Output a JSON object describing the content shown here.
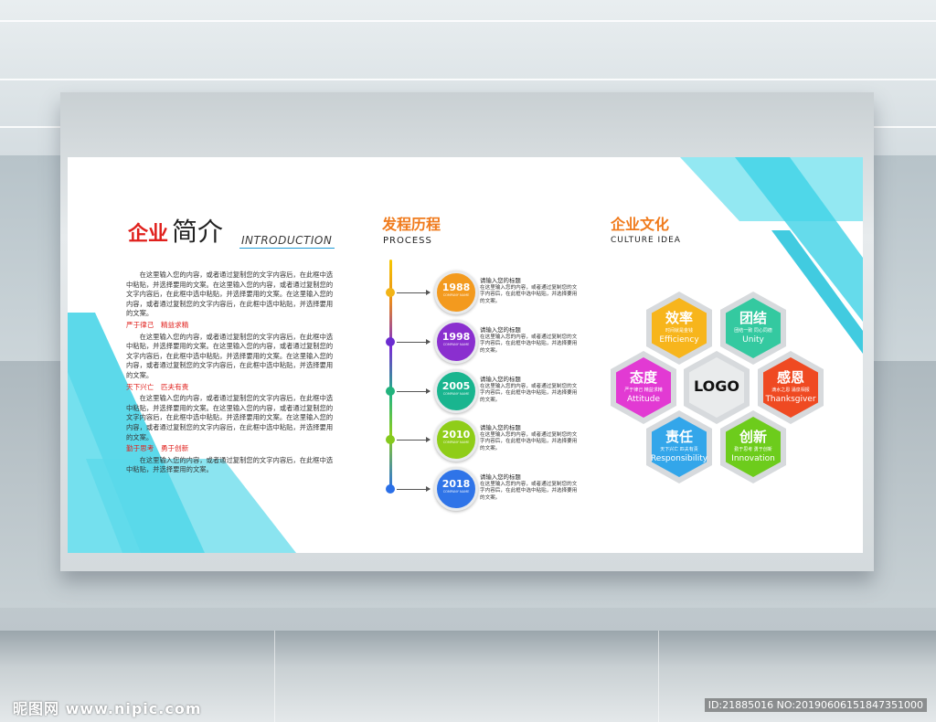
{
  "intro": {
    "title_red": "企业",
    "title_big": "简介",
    "title_en": "INTRODUCTION",
    "paragraphs": [
      "在这里输入您的内容，或者通过复制您的文字内容后，在此框中选中粘贴，并选择要用的文案。在这里输入您的内容，或者通过复制您的文字内容后，在此框中选中粘贴，并选择要用的文案。在这里输入您的内容，或者通过复制您的文字内容后，在此框中选中粘贴，并选择要用的文案。",
      "在这里输入您的内容，或者通过复制您的文字内容后，在此框中选中粘贴，并选择要用的文案。在这里输入您的内容，或者通过复制您的文字内容后，在此框中选中粘贴，并选择要用的文案。在这里输入您的内容，或者通过复制您的文字内容后，在此框中选中粘贴，并选择要用的文案。",
      "在这里输入您的内容，或者通过复制您的文字内容后，在此框中选中粘贴，并选择要用的文案。在这里输入您的内容，或者通过复制您的文字内容后，在此框中选中粘贴，并选择要用的文案。在这里输入您的内容，或者通过复制您的文字内容后，在此框中选中粘贴，并选择要用的文案。",
      "在这里输入您的内容，或者通过复制您的文字内容后，在此框中选中粘贴，并选择要用的文案。"
    ],
    "highlights": [
      "严于律己　精益求精",
      "天下兴亡　匹夫有责",
      "勤于思考　勇于创新"
    ]
  },
  "process": {
    "title": "发程历程",
    "subtitle": "PROCESS",
    "company_name": "COMPANY NAME",
    "item_heading": "请输入您的标题",
    "item_text": "在这里输入您的内容，或者通过复制您的文字内容后，在此框中选中粘贴，并选择要用的文案。",
    "years": [
      {
        "year": "1988",
        "color": "#f39a1e",
        "dot": "#f2b417"
      },
      {
        "year": "1998",
        "color": "#8a2fcf",
        "dot": "#6b2cd0"
      },
      {
        "year": "2005",
        "color": "#19b58f",
        "dot": "#22b37d"
      },
      {
        "year": "2010",
        "color": "#8fcd18",
        "dot": "#85c91d"
      },
      {
        "year": "2018",
        "color": "#2f74e8",
        "dot": "#2a6fe8"
      }
    ]
  },
  "culture": {
    "title": "企业文化",
    "subtitle": "CULTURE  IDEA",
    "logo": "LOGO",
    "values": [
      {
        "cn": "效率",
        "small": "时间就是金钱",
        "en": "Efficiency",
        "color": "#f7b51c"
      },
      {
        "cn": "团结",
        "small": "团结一致 同心同德",
        "en": "Unity",
        "color": "#34c9a0"
      },
      {
        "cn": "态度",
        "small": "严于律己 精益求精",
        "en": "Attitude",
        "color": "#e23ad3"
      },
      {
        "cn": "感恩",
        "small": "滴水之恩 涌泉相报",
        "en": "Thanksgiver",
        "color": "#ef4a22"
      },
      {
        "cn": "责任",
        "small": "天下兴亡 匹夫有责",
        "en": "Responsibility",
        "color": "#33a6ea"
      },
      {
        "cn": "创新",
        "small": "勤于思考 勇于创新",
        "en": "Innovation",
        "color": "#6dcc1c"
      }
    ]
  },
  "watermark": {
    "left": "昵图网 www.nipic.com",
    "right": "ID:21885016 NO:20190606151847351000"
  }
}
